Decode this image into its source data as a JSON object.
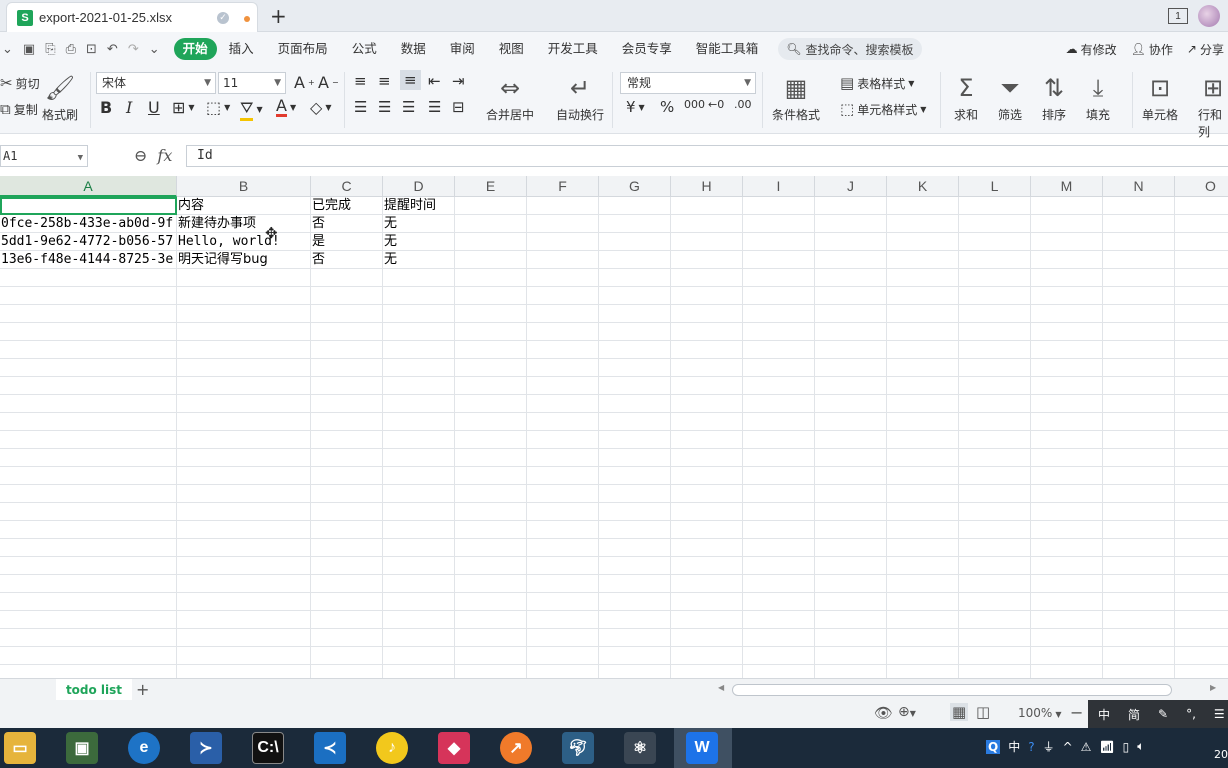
{
  "window": {
    "tab_title": "export-2021-01-25.xlsx",
    "tab_icon_letter": "S",
    "new_tab": "+",
    "window_count": "1"
  },
  "menubar": {
    "items": [
      {
        "label": "开始",
        "active": true
      },
      {
        "label": "插入"
      },
      {
        "label": "页面布局"
      },
      {
        "label": "公式"
      },
      {
        "label": "数据"
      },
      {
        "label": "审阅"
      },
      {
        "label": "视图"
      },
      {
        "label": "开发工具"
      },
      {
        "label": "会员专享"
      },
      {
        "label": "智能工具箱"
      }
    ],
    "search_placeholder": "查找命令、搜索模板",
    "right": {
      "modified": "有修改",
      "collaborate": "协作",
      "share": "分享"
    }
  },
  "ribbon": {
    "cut": "剪切",
    "copy": "复制",
    "format_painter": "格式刷",
    "font_name": "宋体",
    "font_size": "11",
    "bold": "B",
    "italic": "I",
    "underline": "U",
    "merge_center": "合并居中",
    "wrap_text": "自动换行",
    "number_format": "常规",
    "conditional_format": "条件格式",
    "table_style": "表格样式",
    "cell_style": "单元格样式",
    "sum": "求和",
    "filter": "筛选",
    "sort": "排序",
    "fill": "填充",
    "cells": "单元格",
    "rows_cols": "行和列"
  },
  "formula": {
    "name_box": "A1",
    "fx": "fx",
    "value": "Id"
  },
  "sheet": {
    "columns": [
      "A",
      "B",
      "C",
      "D",
      "E",
      "F",
      "G",
      "H",
      "I",
      "J",
      "K",
      "L",
      "M",
      "N",
      "O"
    ],
    "rows": [
      [
        "",
        "内容",
        "已完成",
        "提醒时间"
      ],
      [
        "0fce-258b-433e-ab0d-9f",
        "新建待办事项",
        "否",
        "无"
      ],
      [
        "5dd1-9e62-4772-b056-57",
        "Hello, world!",
        "是",
        "无"
      ],
      [
        "13e6-f48e-4144-8725-3e",
        "明天记得写bug",
        "否",
        "无"
      ]
    ],
    "tabs": [
      {
        "label": "todo list"
      }
    ],
    "add_sheet": "+"
  },
  "status": {
    "zoom": "100%"
  },
  "ime": {
    "mode": "中",
    "simplified": "简"
  },
  "taskbar": {
    "tray_lang": "中",
    "time_partial": "20"
  },
  "colors": {
    "accent": "#1fa55a",
    "taskbar": "#1b2a3a"
  }
}
